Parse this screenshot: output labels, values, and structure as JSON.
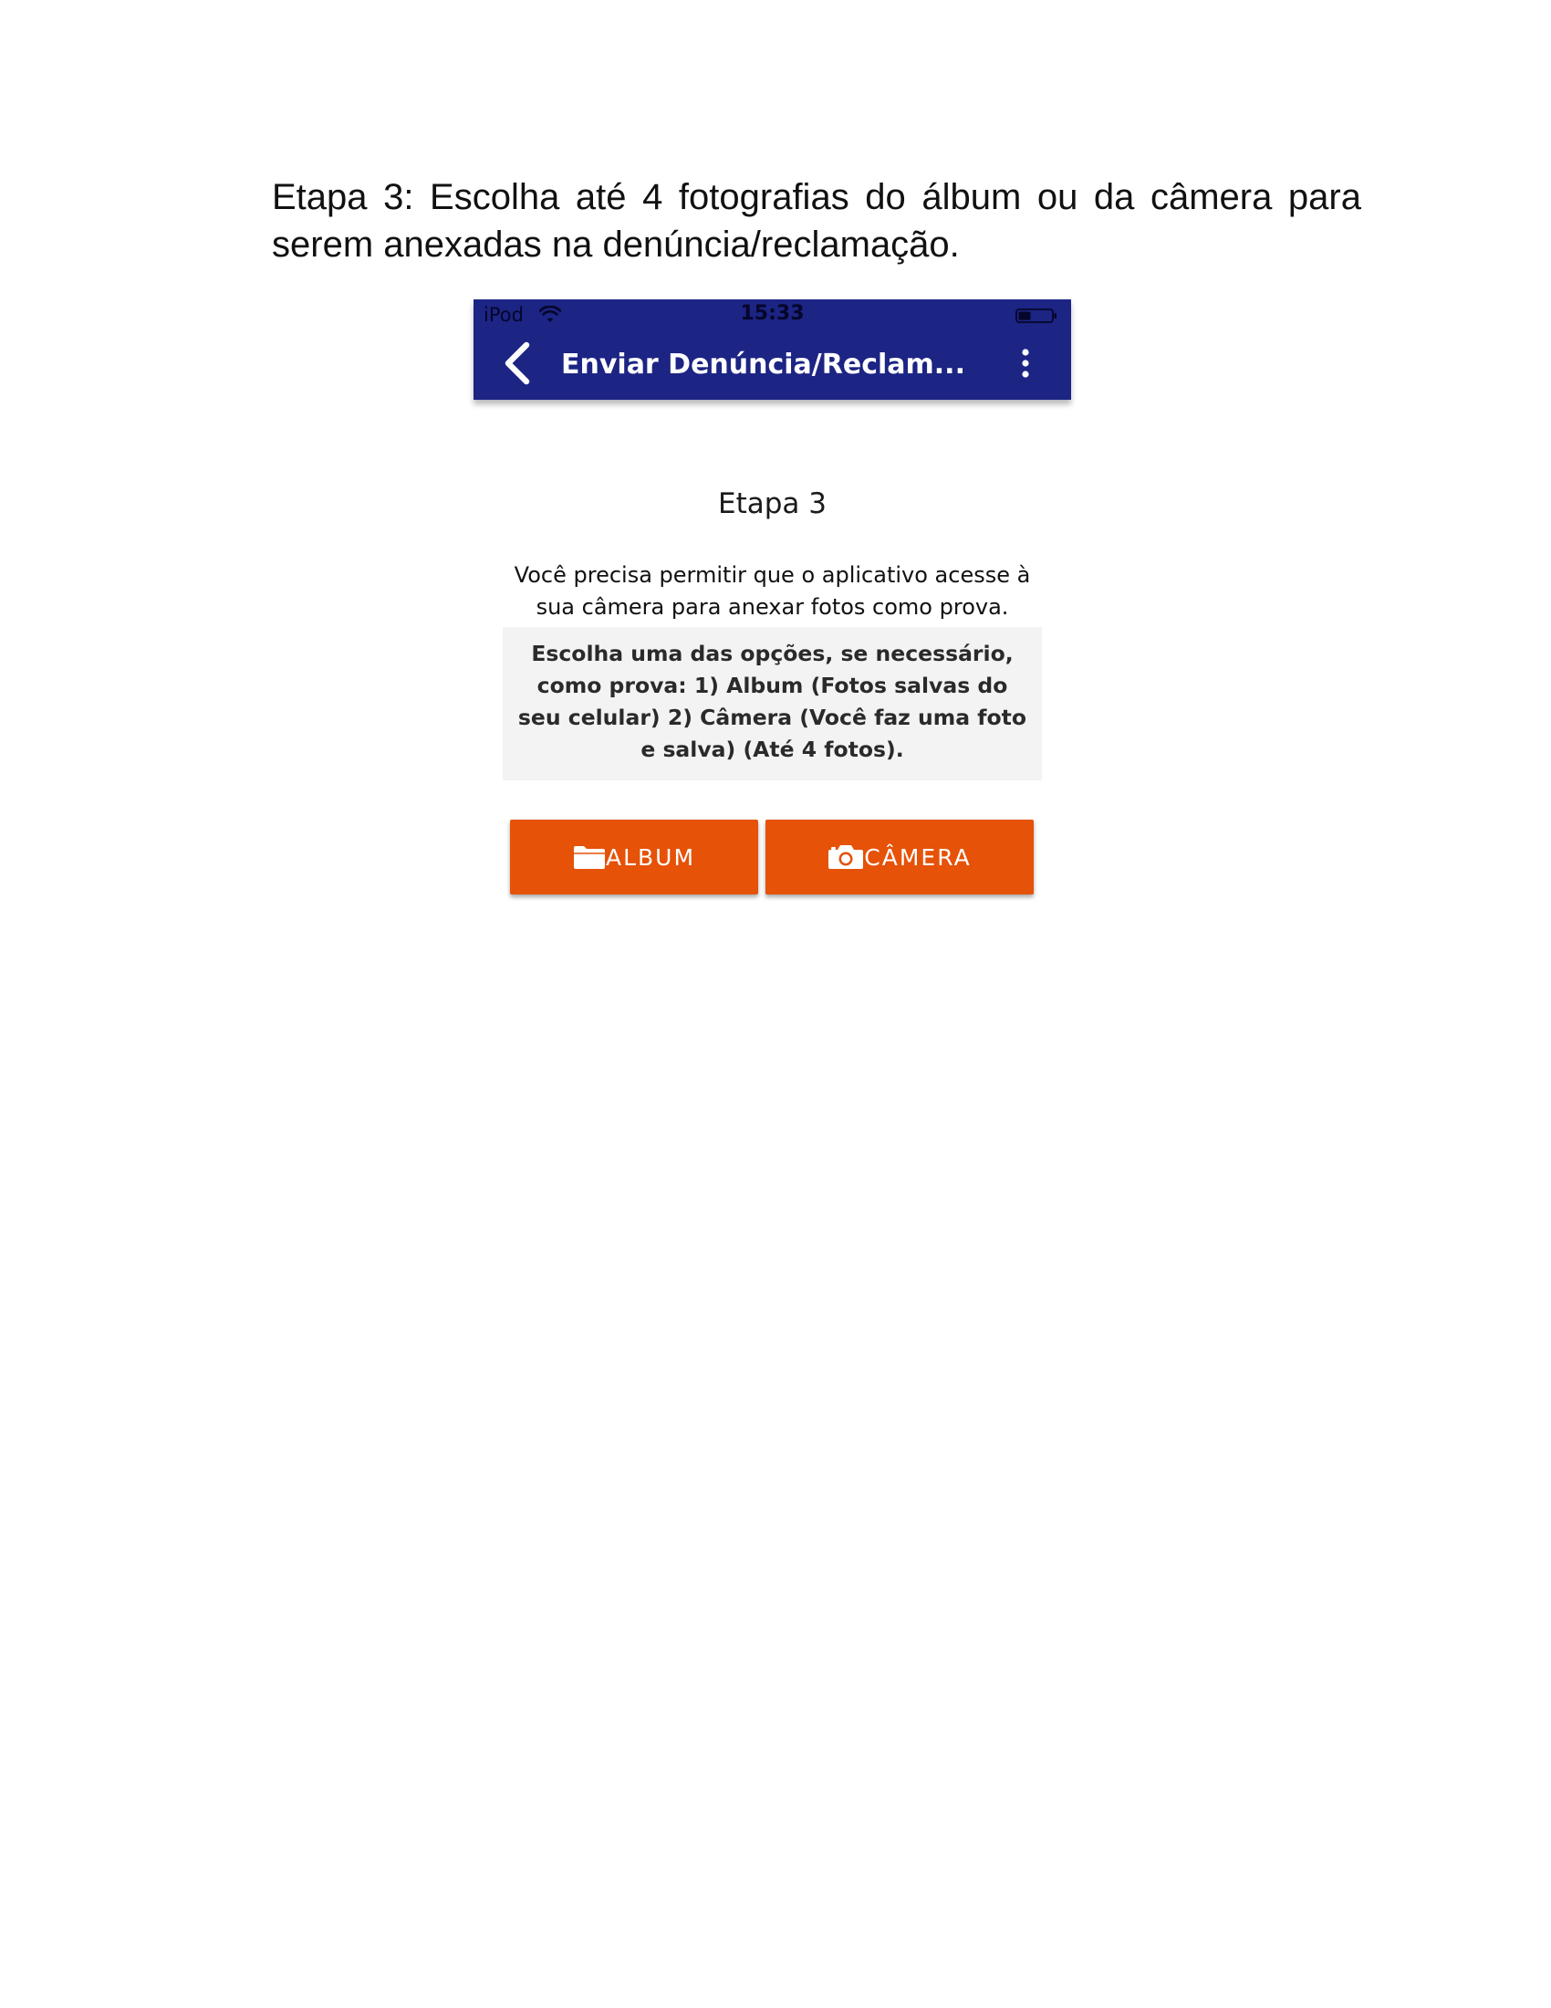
{
  "document": {
    "intro_text": "Etapa 3: Escolha até 4 fotografias do álbum ou da câmera para serem anexadas na denúncia/reclamação."
  },
  "status_bar": {
    "carrier": "iPod",
    "time": "15:33"
  },
  "header": {
    "title": "Enviar Denúncia/Reclam..."
  },
  "content": {
    "step_title": "Etapa 3",
    "permission_text": "Você precisa permitir que o aplicativo acesse à sua câmera para anexar fotos como prova.",
    "info_text": "Escolha uma das opções, se necessário, como prova: 1) Album (Fotos salvas do seu celular) 2) Câmera (Você faz uma foto e salva) (Até 4 fotos)."
  },
  "buttons": {
    "album_label": "ALBUM",
    "camera_label": "CÂMERA"
  },
  "icons": {
    "back": "chevron-left-icon",
    "menu": "more-vertical-icon",
    "album": "folder-icon",
    "camera": "camera-icon",
    "wifi": "wifi-icon",
    "battery": "battery-icon"
  },
  "colors": {
    "header_bg": "#1c2484",
    "button_bg": "#e55208",
    "info_box_bg": "#f3f3f3"
  }
}
